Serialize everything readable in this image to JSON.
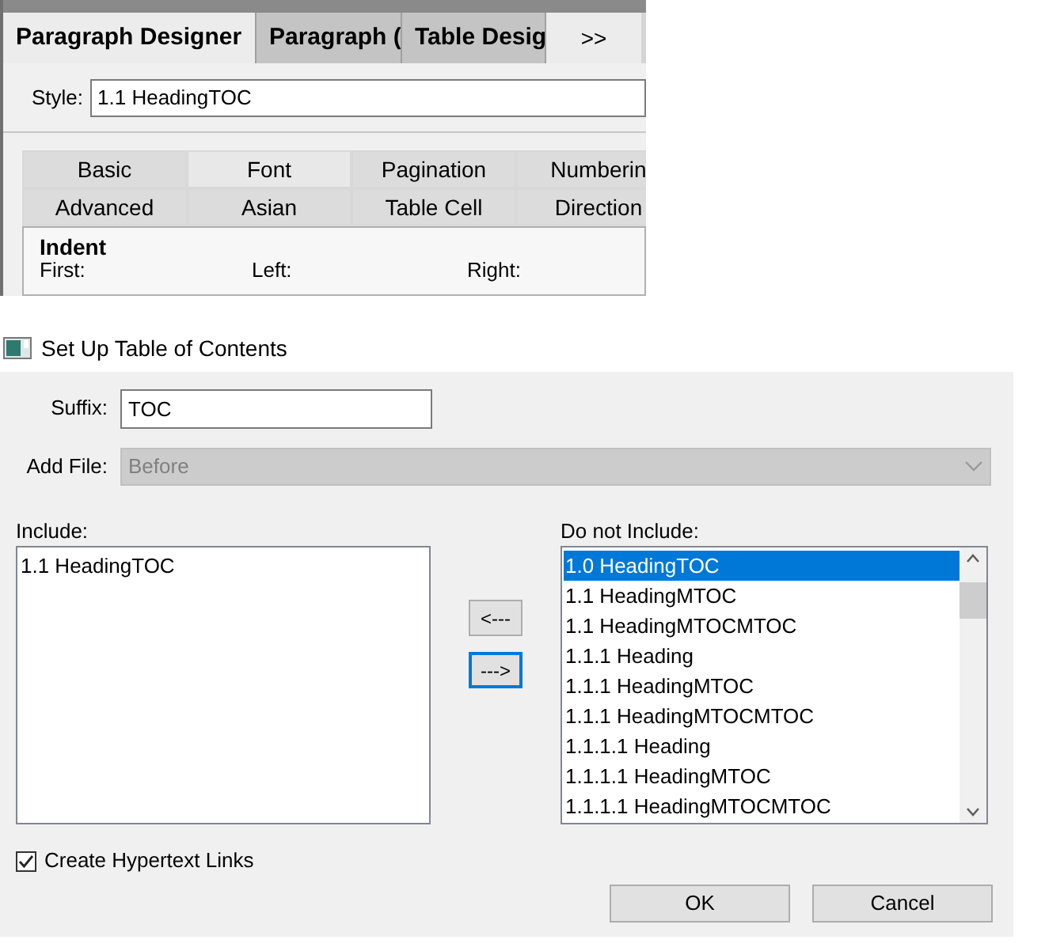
{
  "designer": {
    "tabs": [
      {
        "label": "Paragraph Designer",
        "selected": true
      },
      {
        "label": "Paragraph (",
        "selected": false
      },
      {
        "label": "Table Desig",
        "selected": false
      }
    ],
    "more_tabs": ">>",
    "style": {
      "label": "Style:",
      "value": "1.1 HeadingTOC"
    },
    "property_tabs": [
      {
        "label": "Basic",
        "selected": false
      },
      {
        "label": "Font",
        "selected": true
      },
      {
        "label": "Pagination",
        "selected": false
      },
      {
        "label": "Numberin",
        "selected": false
      },
      {
        "label": "Advanced",
        "selected": false
      },
      {
        "label": "Asian",
        "selected": false
      },
      {
        "label": "Table Cell",
        "selected": false
      },
      {
        "label": "Direction",
        "selected": false
      }
    ],
    "section_title": "Indent",
    "fields": [
      "First:",
      "Left:",
      "Right:"
    ]
  },
  "dialog": {
    "title": "Set Up Table of Contents",
    "suffix": {
      "label": "Suffix:",
      "value": "TOC"
    },
    "add_file": {
      "label": "Add File:",
      "value": "Before",
      "disabled": true
    },
    "include": {
      "label": "Include:",
      "items": [
        {
          "text": "1.1 HeadingTOC",
          "selected": false
        }
      ]
    },
    "exclude": {
      "label": "Do not Include:",
      "items": [
        {
          "text": "1.0 HeadingTOC",
          "selected": true
        },
        {
          "text": "1.1 HeadingMTOC",
          "selected": false
        },
        {
          "text": "1.1 HeadingMTOCMTOC",
          "selected": false
        },
        {
          "text": "1.1.1 Heading",
          "selected": false
        },
        {
          "text": "1.1.1 HeadingMTOC",
          "selected": false
        },
        {
          "text": "1.1.1 HeadingMTOCMTOC",
          "selected": false
        },
        {
          "text": "1.1.1.1 Heading",
          "selected": false
        },
        {
          "text": "1.1.1.1 HeadingMTOC",
          "selected": false
        },
        {
          "text": "1.1.1.1 HeadingMTOCMTOC",
          "selected": false
        }
      ]
    },
    "move_buttons": [
      {
        "label": "<---",
        "focused": false
      },
      {
        "label": "--->",
        "focused": true
      }
    ],
    "hypertext": {
      "label": "Create Hypertext Links",
      "checked": true
    },
    "buttons": [
      "OK",
      "Cancel"
    ]
  }
}
